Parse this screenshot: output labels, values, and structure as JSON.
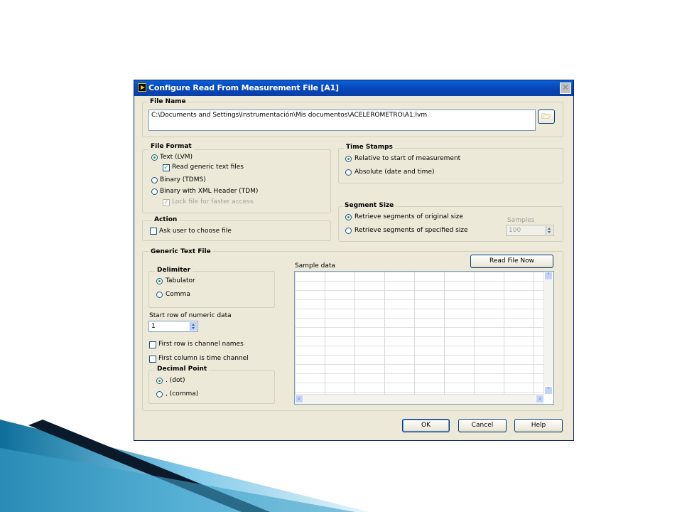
{
  "window": {
    "title": "Configure Read From Measurement File [A1]"
  },
  "file_name": {
    "label": "File Name",
    "path": "C:\\Documents and Settings\\Instrumentación\\Mis documentos\\ACELEROMETRO\\A1.lvm",
    "browse_icon": "folder-open-icon"
  },
  "file_format": {
    "label": "File Format",
    "text_lvm": "Text (LVM)",
    "read_generic": "Read generic text files",
    "binary_tdms": "Binary (TDMS)",
    "binary_xml": "Binary with XML Header (TDM)",
    "lock_file": "Lock file for faster access"
  },
  "action": {
    "label": "Action",
    "ask_user": "Ask user to choose file"
  },
  "time_stamps": {
    "label": "Time Stamps",
    "relative": "Relative to start of measurement",
    "absolute": "Absolute (date and time)"
  },
  "segment_size": {
    "label": "Segment Size",
    "original": "Retrieve segments of original size",
    "specified": "Retrieve segments of specified size",
    "samples_label": "Samples",
    "samples_value": "100"
  },
  "generic_text": {
    "label": "Generic Text File",
    "delimiter_label": "Delimiter",
    "tabulator": "Tabulator",
    "comma": "Comma",
    "start_row_label": "Start row of numeric data",
    "start_row_value": "1",
    "first_row_names": "First row is channel names",
    "first_col_time": "First column is time channel",
    "decimal_label": "Decimal Point",
    "dot": ". (dot)",
    "comma_dp": ", (comma)",
    "sample_data_label": "Sample data",
    "read_now": "Read File Now"
  },
  "buttons": {
    "ok": "OK",
    "cancel": "Cancel",
    "help": "Help"
  },
  "colors": {
    "titlebar": "#0a5fd8",
    "dialog_bg": "#ece9d8",
    "accent_dark": "#0a1a2a",
    "accent_light": "#7ec8e8"
  }
}
